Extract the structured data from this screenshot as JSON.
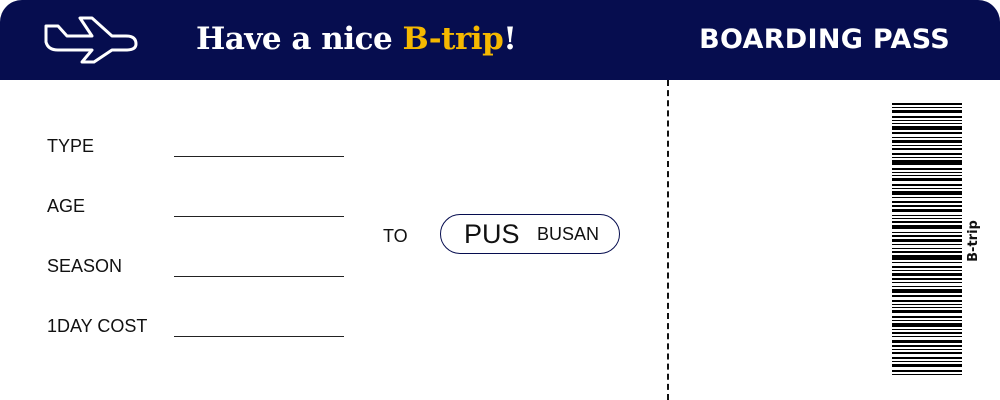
{
  "header": {
    "greeting_prefix": "Have a nice ",
    "greeting_brand": "B-trip",
    "greeting_suffix": "!",
    "title": "BOARDING PASS",
    "icon": "airplane-icon"
  },
  "fields": [
    {
      "label": "TYPE",
      "value": ""
    },
    {
      "label": "AGE",
      "value": ""
    },
    {
      "label": "SEASON",
      "value": ""
    },
    {
      "label": "1DAY COST",
      "value": ""
    }
  ],
  "destination": {
    "to_label": "TO",
    "code": "PUS",
    "city": "BUSAN"
  },
  "barcode": {
    "label": "B-trip"
  },
  "colors": {
    "header_bg": "#060d4f",
    "accent": "#f5b800",
    "text": "#111111",
    "background": "#ffffff"
  }
}
